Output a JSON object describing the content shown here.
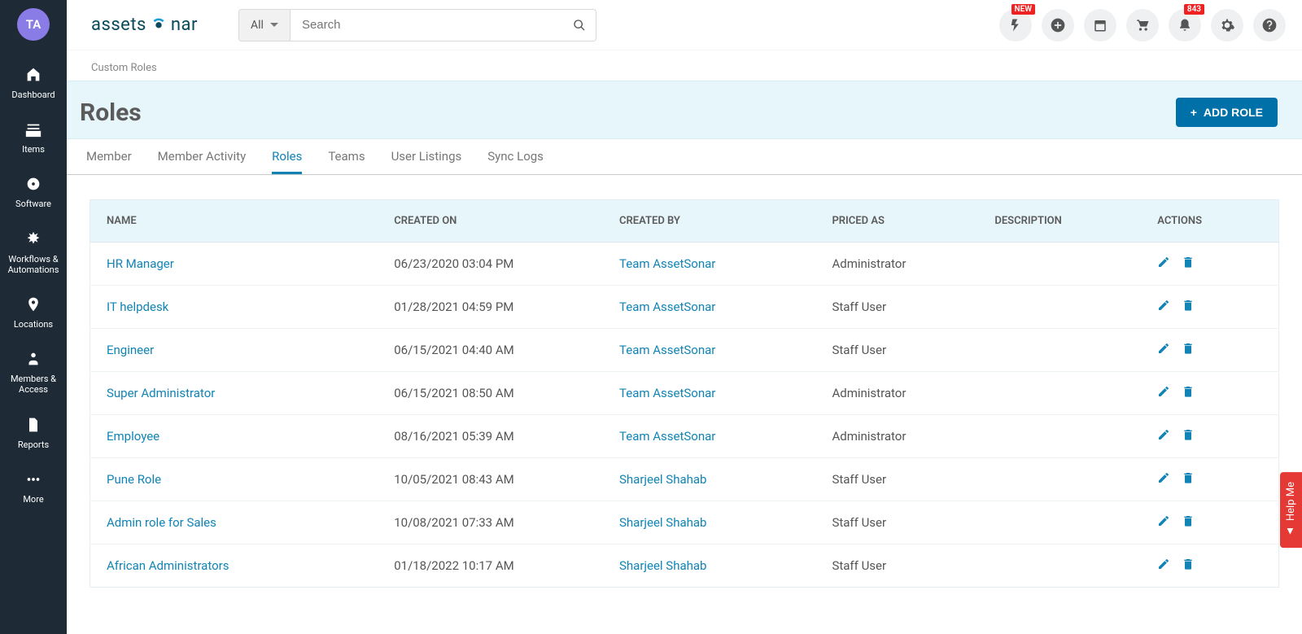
{
  "avatar_initials": "TA",
  "logo_text_1": "assets",
  "logo_text_2": "nar",
  "search": {
    "filter_label": "All",
    "placeholder": "Search"
  },
  "sidebar": [
    {
      "label": "Dashboard"
    },
    {
      "label": "Items"
    },
    {
      "label": "Software"
    },
    {
      "label": "Workflows & Automations"
    },
    {
      "label": "Locations"
    },
    {
      "label": "Members & Access"
    },
    {
      "label": "Reports"
    },
    {
      "label": "More"
    }
  ],
  "top_badges": {
    "flash": "NEW",
    "bell": "843"
  },
  "breadcrumb": "Custom Roles",
  "page_title": "Roles",
  "add_button_label": "ADD ROLE",
  "tabs": [
    {
      "label": "Member",
      "active": false
    },
    {
      "label": "Member Activity",
      "active": false
    },
    {
      "label": "Roles",
      "active": true
    },
    {
      "label": "Teams",
      "active": false
    },
    {
      "label": "User Listings",
      "active": false
    },
    {
      "label": "Sync Logs",
      "active": false
    }
  ],
  "table": {
    "headers": {
      "name": "NAME",
      "created_on": "CREATED ON",
      "created_by": "CREATED BY",
      "priced_as": "PRICED AS",
      "description": "DESCRIPTION",
      "actions": "ACTIONS"
    },
    "rows": [
      {
        "name": "HR Manager",
        "created_on": "06/23/2020 03:04 PM",
        "created_by": "Team AssetSonar",
        "priced_as": "Administrator",
        "description": ""
      },
      {
        "name": "IT helpdesk",
        "created_on": "01/28/2021 04:59 PM",
        "created_by": "Team AssetSonar",
        "priced_as": "Staff User",
        "description": ""
      },
      {
        "name": "Engineer",
        "created_on": "06/15/2021 04:40 AM",
        "created_by": "Team AssetSonar",
        "priced_as": "Staff User",
        "description": ""
      },
      {
        "name": "Super Administrator",
        "created_on": "06/15/2021 08:50 AM",
        "created_by": "Team AssetSonar",
        "priced_as": "Administrator",
        "description": ""
      },
      {
        "name": "Employee",
        "created_on": "08/16/2021 05:39 AM",
        "created_by": "Team AssetSonar",
        "priced_as": "Administrator",
        "description": ""
      },
      {
        "name": "Pune Role",
        "created_on": "10/05/2021 08:43 AM",
        "created_by": "Sharjeel Shahab",
        "priced_as": "Staff User",
        "description": ""
      },
      {
        "name": "Admin role for Sales",
        "created_on": "10/08/2021 07:33 AM",
        "created_by": "Sharjeel Shahab",
        "priced_as": "Staff User",
        "description": ""
      },
      {
        "name": "African Administrators",
        "created_on": "01/18/2022 10:17 AM",
        "created_by": "Sharjeel Shahab",
        "priced_as": "Staff User",
        "description": ""
      }
    ]
  },
  "help_tab": "Help Me"
}
